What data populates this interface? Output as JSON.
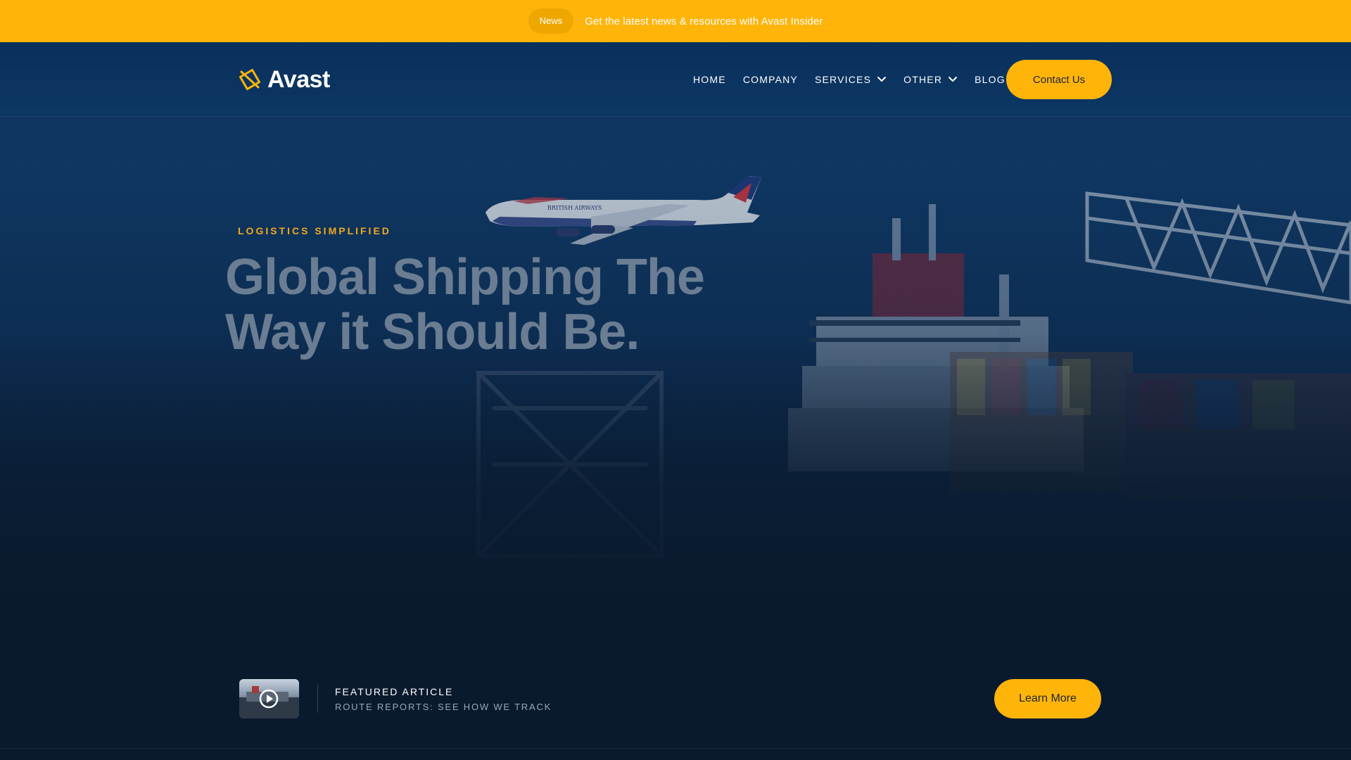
{
  "announcement": {
    "badge": "News",
    "message": "Get the latest news & resources with Avast Insider"
  },
  "header": {
    "logo_text": "Avast",
    "nav": [
      {
        "label": "HOME",
        "has_dropdown": false
      },
      {
        "label": "COMPANY",
        "has_dropdown": false
      },
      {
        "label": "SERVICES",
        "has_dropdown": true
      },
      {
        "label": "OTHER",
        "has_dropdown": true
      },
      {
        "label": "BLOG",
        "has_dropdown": false
      }
    ],
    "cta_label": "Contact Us"
  },
  "hero": {
    "eyebrow": "LOGISTICS SIMPLIFIED",
    "headline": "Global Shipping The Way it Should Be."
  },
  "featured": {
    "title": "FEATURED ARTICLE",
    "subtitle": "ROUTE REPORTS: SEE HOW WE TRACK",
    "cta_label": "Learn More"
  },
  "colors": {
    "accent": "#ffb40a",
    "navy": "#0d3562",
    "eyebrow": "#f2a91a",
    "headline": "#6b7d92"
  },
  "icons": {
    "logo": "avast-logo-icon",
    "dropdown": "chevron-down-icon",
    "play": "play-icon"
  }
}
